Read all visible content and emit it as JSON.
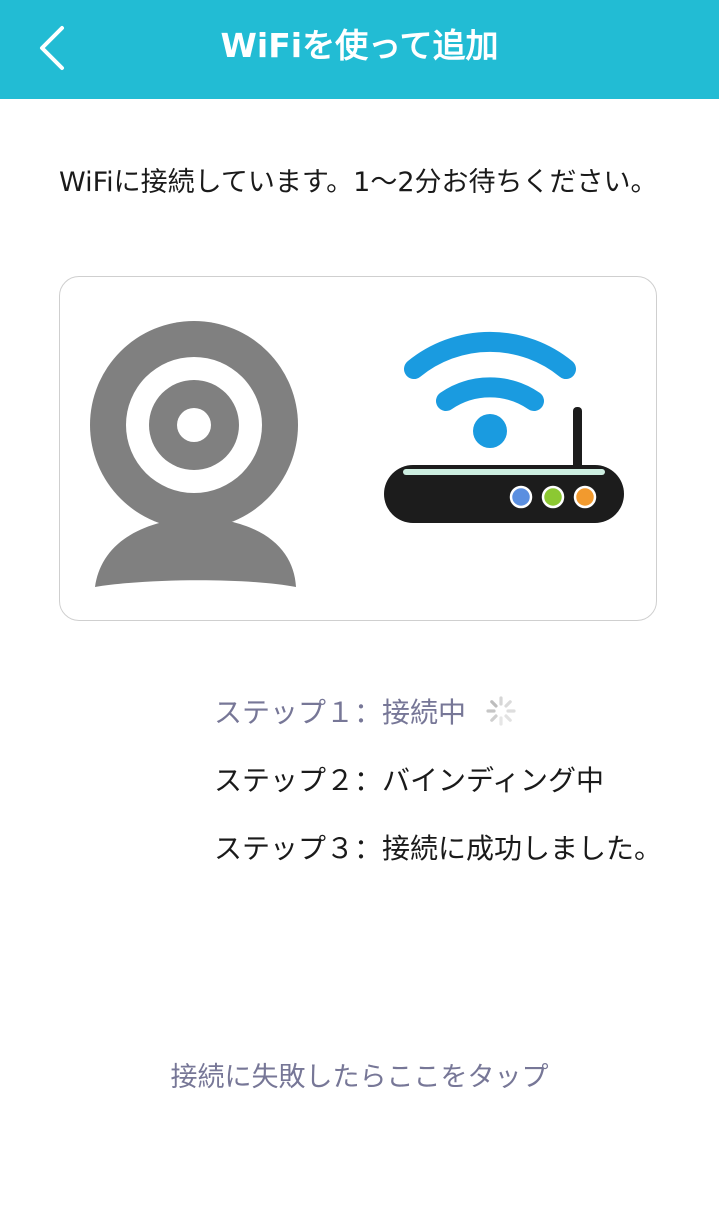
{
  "header": {
    "title": "WiFiを使って追加",
    "background_color": "#22bcd4",
    "back_icon": "chevron-left-icon"
  },
  "instruction": "WiFiに接続しています。1〜2分お待ちください。",
  "illustration": {
    "left": "webcam-icon",
    "right": "wifi-router-icon",
    "router_lights": [
      "#5b8fe0",
      "#8cc832",
      "#f29a2e"
    ]
  },
  "steps": [
    {
      "label": "ステップ１：接続中",
      "state": "active",
      "icon": "loading-spinner-icon"
    },
    {
      "label": "ステップ２：バインディング中",
      "state": "pending"
    },
    {
      "label": "ステップ３：接続に成功しました。",
      "state": "pending"
    }
  ],
  "colors": {
    "active_step": "#777797",
    "pending_step": "#1a1a1a",
    "wifi_blue": "#1a9be0",
    "camera_gray": "#808080"
  },
  "footer": {
    "tap_link": "接続に失敗したらここをタップ"
  }
}
